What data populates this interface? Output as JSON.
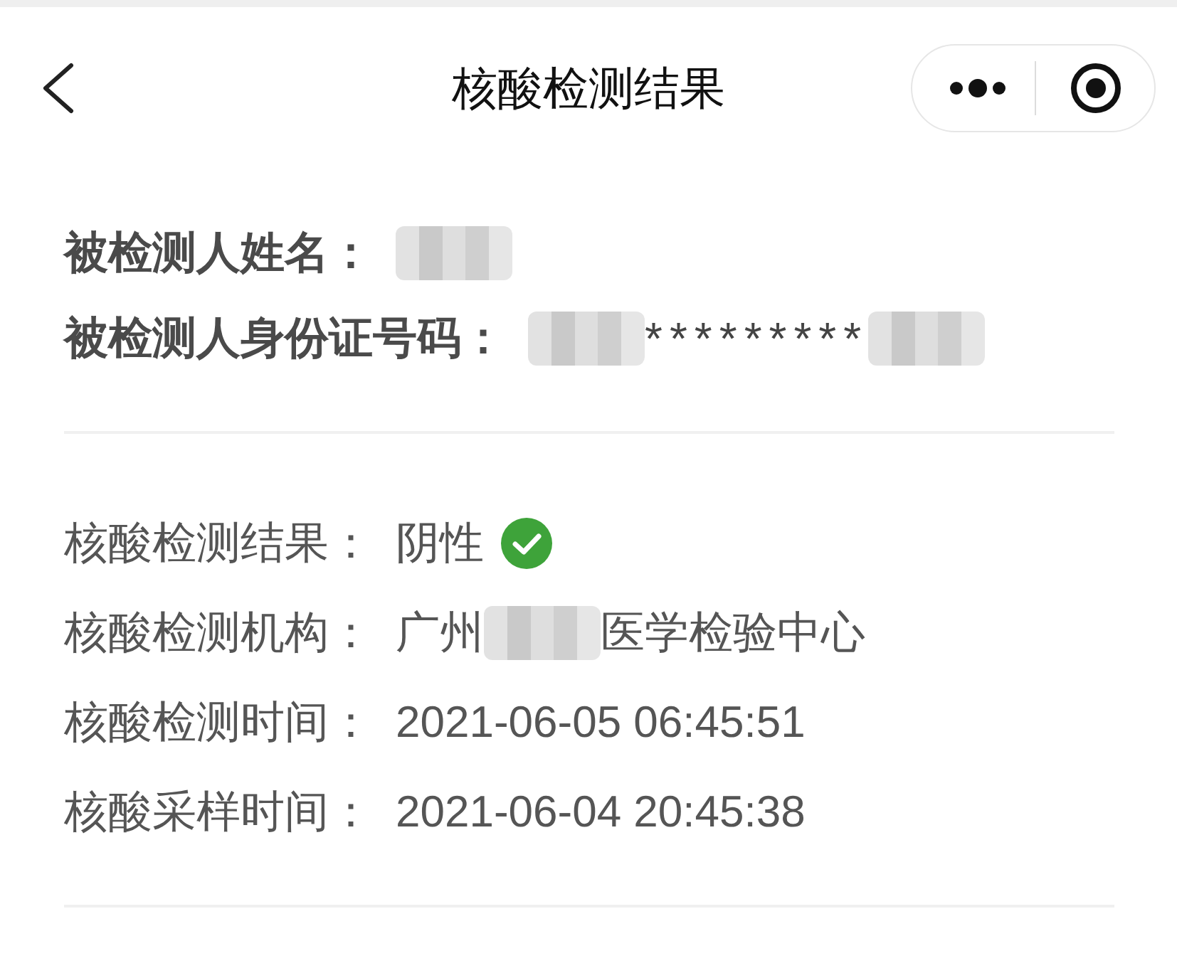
{
  "nav_bar": {
    "title": "核酸检测结果"
  },
  "sections": [
    {
      "kind": "subject",
      "rows": [
        {
          "label": "被检测人姓名：",
          "value": [
            {
              "kind": "redacted"
            }
          ]
        },
        {
          "label": "被检测人身份证号码：",
          "value": [
            {
              "kind": "redacted"
            },
            {
              "kind": "text",
              "text": "*********"
            },
            {
              "kind": "redacted"
            }
          ]
        }
      ]
    },
    {
      "kind": "detail",
      "rows": [
        {
          "label": "核酸检测结果：",
          "value": [
            {
              "kind": "text",
              "text": "阴性"
            },
            {
              "kind": "check"
            }
          ]
        },
        {
          "label": "核酸检测机构：",
          "value": [
            {
              "kind": "text",
              "text": "广州"
            },
            {
              "kind": "redacted"
            },
            {
              "kind": "text",
              "text": "医学检验中心"
            }
          ]
        },
        {
          "label": "核酸检测时间：",
          "value": [
            {
              "kind": "text",
              "text": "2021-06-05 06:45:51"
            }
          ]
        },
        {
          "label": "核酸采样时间：",
          "value": [
            {
              "kind": "text",
              "text": "2021-06-04 20:45:38"
            }
          ]
        }
      ]
    }
  ]
}
